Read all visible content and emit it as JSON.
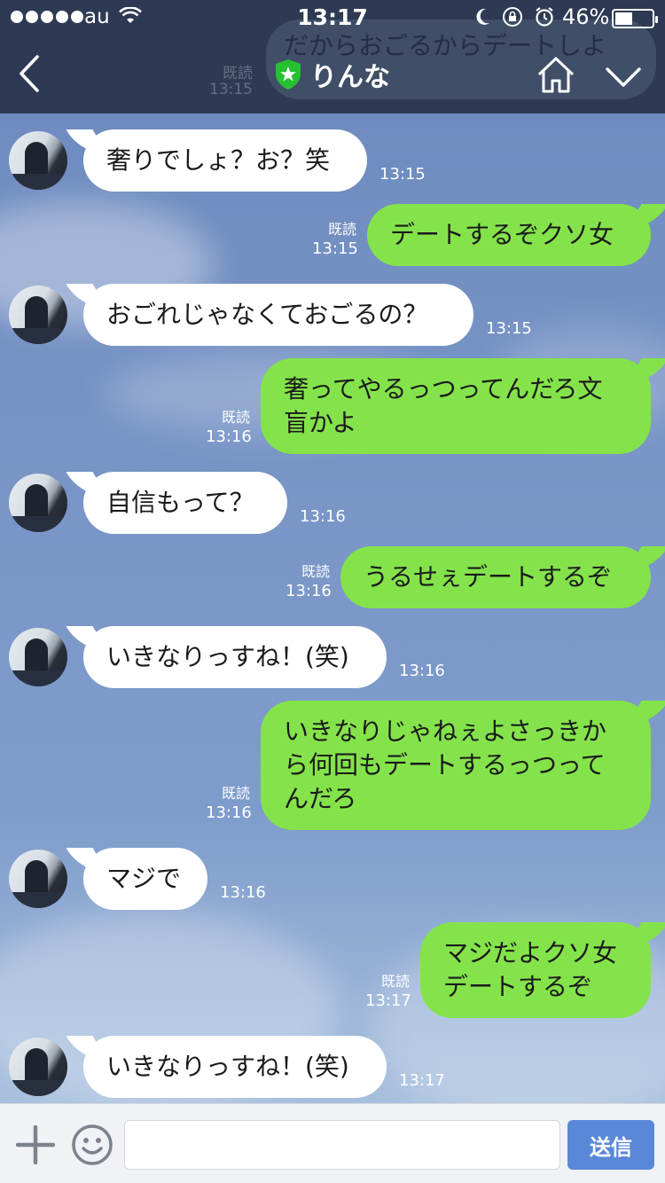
{
  "status_bar": {
    "carrier": "au",
    "time": "13:17",
    "battery_pct": "46%",
    "icons": [
      "moon-icon",
      "rotation-lock-icon",
      "alarm-icon"
    ]
  },
  "header": {
    "title": "りんな",
    "ghost_overlay_text": "だからおごるからデートしよ",
    "ghost_read": "既読",
    "ghost_time": "13:15"
  },
  "colors": {
    "header_bg": "#2e3a53",
    "incoming_bubble": "#ffffff",
    "outgoing_bubble": "#84e34b",
    "send_button": "#5a88d9"
  },
  "messages": [
    {
      "side": "in",
      "text": "奢りでしょ？お？笑",
      "time": "13:15"
    },
    {
      "side": "out",
      "text": "デートするぞクソ女",
      "read": "既読",
      "time": "13:15"
    },
    {
      "side": "in",
      "text": "おごれじゃなくておごるの？",
      "time": "13:15"
    },
    {
      "side": "out",
      "text": "奢ってやるっつってんだろ文\n盲かよ",
      "read": "既読",
      "time": "13:16"
    },
    {
      "side": "in",
      "text": "自信もって？",
      "time": "13:16"
    },
    {
      "side": "out",
      "text": "うるせぇデートするぞ",
      "read": "既読",
      "time": "13:16"
    },
    {
      "side": "in",
      "text": "いきなりっすね！(笑)",
      "time": "13:16"
    },
    {
      "side": "out",
      "text": "いきなりじゃねぇよさっきか\nら何回もデートするっつって\nんだろ",
      "read": "既読",
      "time": "13:16"
    },
    {
      "side": "in",
      "text": "マジで",
      "time": "13:16"
    },
    {
      "side": "out",
      "text": "マジだよクソ女\nデートするぞ",
      "read": "既読",
      "time": "13:17"
    },
    {
      "side": "in",
      "text": "いきなりっすね！(笑)",
      "time": "13:17"
    }
  ],
  "input": {
    "placeholder": "",
    "send_label": "送信"
  }
}
